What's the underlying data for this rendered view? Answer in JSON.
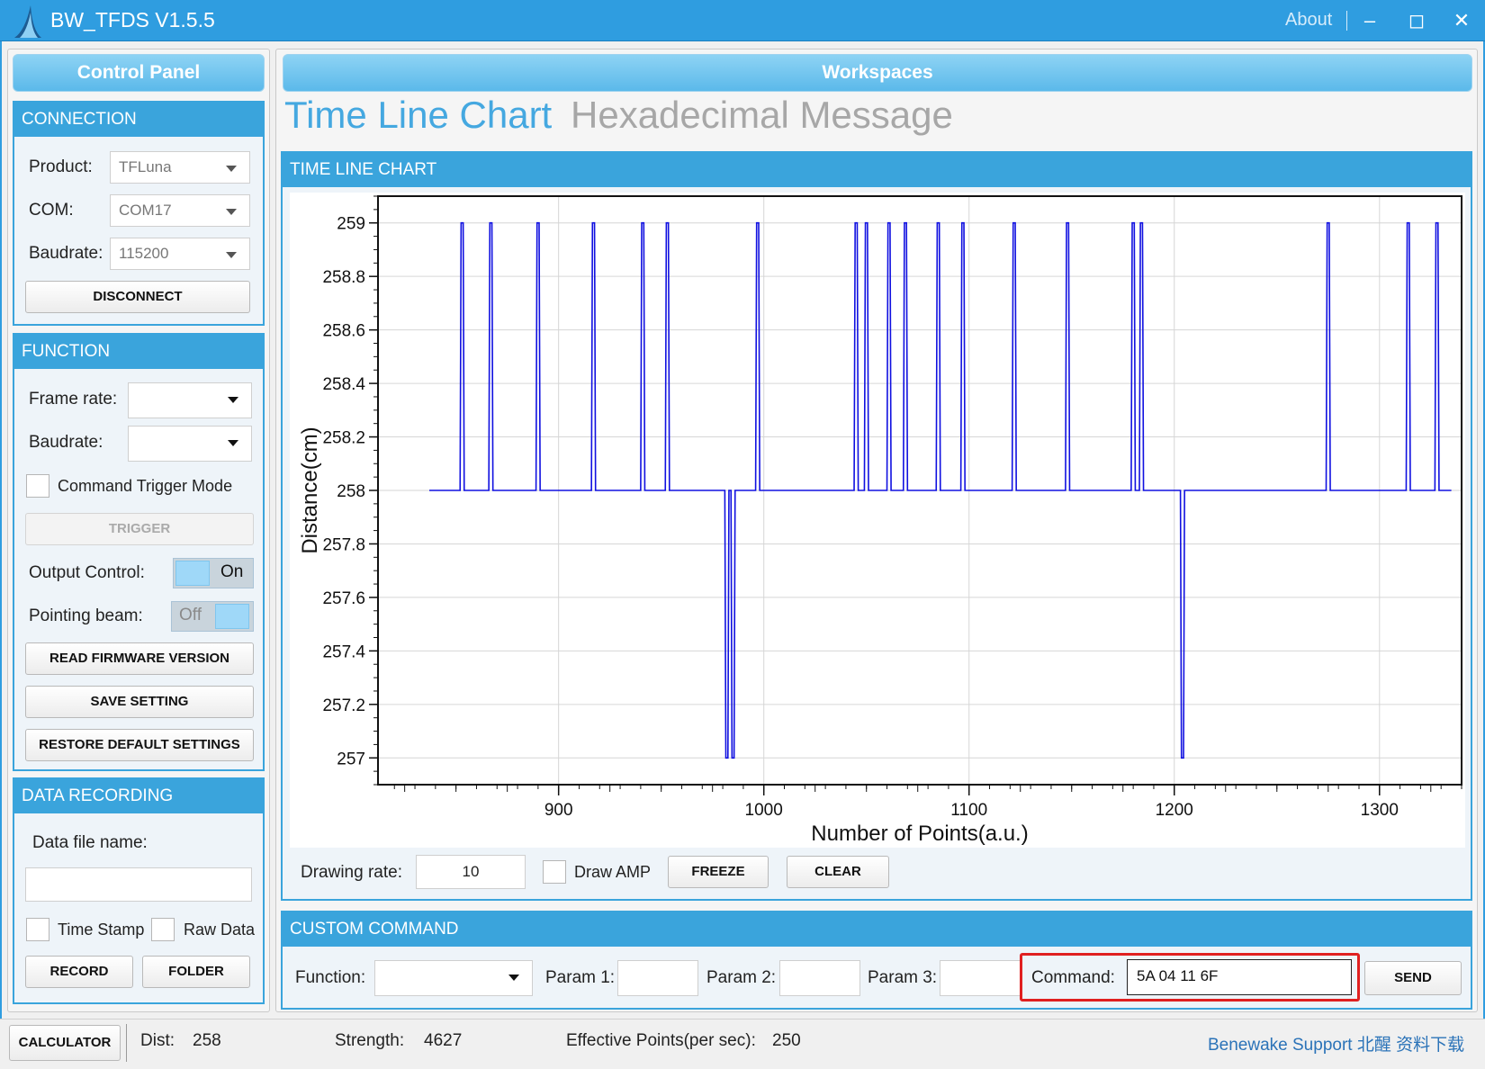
{
  "window": {
    "title": "BW_TFDS V1.5.5",
    "about_label": "About",
    "minimize_glyph": "–",
    "maximize_glyph": "◻",
    "close_glyph": "✕"
  },
  "control_panel": {
    "header": "Control Panel",
    "connection": {
      "title": "CONNECTION",
      "product_label": "Product:",
      "product_value": "TFLuna",
      "com_label": "COM:",
      "com_value": "COM17",
      "baudrate_label": "Baudrate:",
      "baudrate_value": "115200",
      "disconnect_label": "DISCONNECT"
    },
    "function": {
      "title": "FUNCTION",
      "frame_rate_label": "Frame rate:",
      "frame_rate_value": "",
      "baudrate_label": "Baudrate:",
      "baudrate_value": "",
      "command_trigger_label": "Command Trigger Mode",
      "trigger_label": "TRIGGER",
      "output_control_label": "Output Control:",
      "output_control_state": "On",
      "pointing_beam_label": "Pointing beam:",
      "pointing_beam_state": "Off",
      "read_firmware_label": "READ FIRMWARE VERSION",
      "save_setting_label": "SAVE SETTING",
      "restore_default_label": "RESTORE DEFAULT SETTINGS"
    },
    "data_recording": {
      "title": "DATA RECORDING",
      "file_name_label": "Data file name:",
      "file_name_value": "",
      "time_stamp_label": "Time Stamp",
      "raw_data_label": "Raw Data",
      "record_label": "RECORD",
      "folder_label": "FOLDER"
    }
  },
  "workspaces": {
    "header": "Workspaces",
    "tabs": [
      {
        "label": "Time Line Chart",
        "active": true
      },
      {
        "label": "Hexadecimal Message",
        "active": false
      }
    ],
    "chart_section_title": "TIME LINE CHART",
    "drawing_rate_label": "Drawing rate:",
    "drawing_rate_value": "10",
    "draw_amp_label": "Draw AMP",
    "freeze_label": "FREEZE",
    "clear_label": "CLEAR"
  },
  "chart_data": {
    "type": "line",
    "xlabel": "Number of Points(a.u.)",
    "ylabel": "Distance(cm)",
    "xlim": [
      812,
      1340
    ],
    "ylim": [
      256.9,
      259.1
    ],
    "xticks": [
      900,
      1000,
      1100,
      1200,
      1300
    ],
    "yticks": [
      257,
      257.2,
      257.4,
      257.6,
      257.8,
      258,
      258.2,
      258.4,
      258.6,
      258.8,
      259
    ],
    "grid": true,
    "series": [
      {
        "color": "#1010e0",
        "baseline": 258,
        "x_start": 837,
        "x_end": 1335,
        "spikes_up_to_259": [
          853,
          867,
          890,
          917,
          941,
          953,
          997,
          1045,
          1050,
          1061,
          1069,
          1085,
          1097,
          1122,
          1148,
          1180,
          1184,
          1275,
          1314,
          1328
        ],
        "dips_down_to_257": [
          982,
          985,
          1204
        ]
      }
    ]
  },
  "custom_command": {
    "title": "CUSTOM COMMAND",
    "function_label": "Function:",
    "function_value": "",
    "param1_label": "Param 1:",
    "param1_value": "",
    "param2_label": "Param 2:",
    "param2_value": "",
    "param3_label": "Param 3:",
    "param3_value": "",
    "command_label": "Command:",
    "command_value": "5A 04 11 6F",
    "send_label": "SEND"
  },
  "status_bar": {
    "calculator_label": "CALCULATOR",
    "dist_label": "Dist:",
    "dist_value": "258",
    "strength_label": "Strength:",
    "strength_value": "4627",
    "effective_label": "Effective Points(per sec):",
    "effective_value": "250",
    "support_label": "Benewake Support 北醒 资料下载"
  },
  "colors": {
    "accent": "#3aa4dc",
    "title_bar": "#2f9de0",
    "highlight_box": "#e02020",
    "plot_line": "#1010e0"
  }
}
